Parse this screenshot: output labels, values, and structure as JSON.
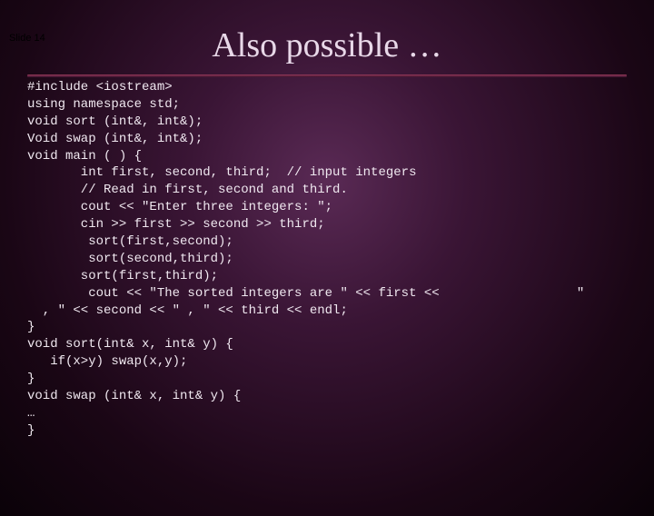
{
  "slide_label": "Slide 14",
  "title": "Also possible …",
  "code": "#include <iostream>\nusing namespace std;\nvoid sort (int&, int&);\nVoid swap (int&, int&);\nvoid main ( ) {\n       int first, second, third;  // input integers\n       // Read in first, second and third.\n       cout << \"Enter three integers: \";\n       cin >> first >> second >> third;\n        sort(first,second);\n        sort(second,third);\n       sort(first,third);\n        cout << \"The sorted integers are \" << first <<                  \"\n  , \" << second << \" , \" << third << endl;\n}\nvoid sort(int& x, int& y) {\n   if(x>y) swap(x,y);\n}\nvoid swap (int& x, int& y) {\n…\n}"
}
